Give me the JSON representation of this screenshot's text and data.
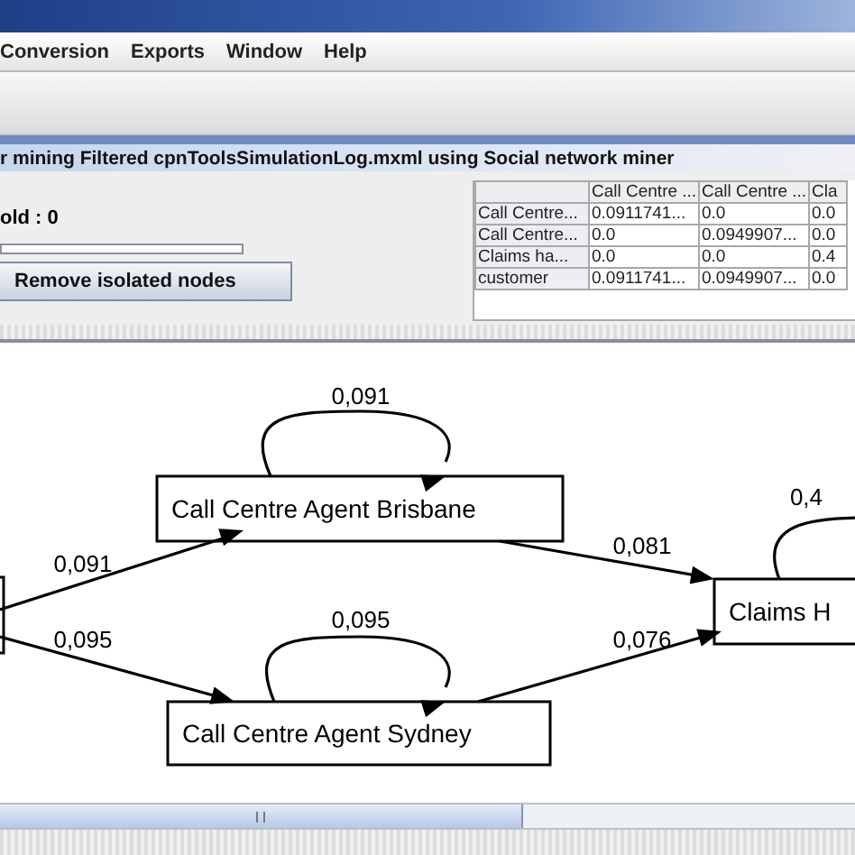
{
  "menu": [
    "Conversion",
    "Exports",
    "Window",
    "Help"
  ],
  "frame_title": "r mining Filtered cpnToolsSimulationLog.mxml using Social network miner",
  "threshold_label": "old : 0",
  "remove_button": "Remove isolated nodes",
  "table": {
    "columns": [
      "Call Centre ...",
      "Call Centre ...",
      "Cla"
    ],
    "rows": [
      {
        "header": "Call Centre...",
        "cells": [
          "0.0911741...",
          "0.0",
          "0.0"
        ]
      },
      {
        "header": "Call Centre...",
        "cells": [
          "0.0",
          "0.0949907...",
          "0.0"
        ]
      },
      {
        "header": "Claims ha...",
        "cells": [
          "0.0",
          "0.0",
          "0.4"
        ]
      },
      {
        "header": "customer",
        "cells": [
          "0.0911741...",
          "0.0949907...",
          "0.0"
        ]
      }
    ]
  },
  "graph": {
    "nodes": [
      {
        "kind": "stub"
      },
      {
        "kind": "box",
        "label": "Call Centre Agent Brisbane"
      },
      {
        "kind": "box",
        "label": "Call Centre Agent Sydney"
      },
      {
        "kind": "box",
        "label": "Claims H"
      }
    ],
    "edges": [
      {
        "kind": "loop",
        "label": "0,091"
      },
      {
        "kind": "link",
        "label": "0,091"
      },
      {
        "kind": "link",
        "label": "0,095"
      },
      {
        "kind": "loop",
        "label": "0,095"
      },
      {
        "kind": "link",
        "label": "0,081"
      },
      {
        "kind": "link",
        "label": "0,076"
      },
      {
        "kind": "loop",
        "label": "0,4"
      }
    ]
  }
}
